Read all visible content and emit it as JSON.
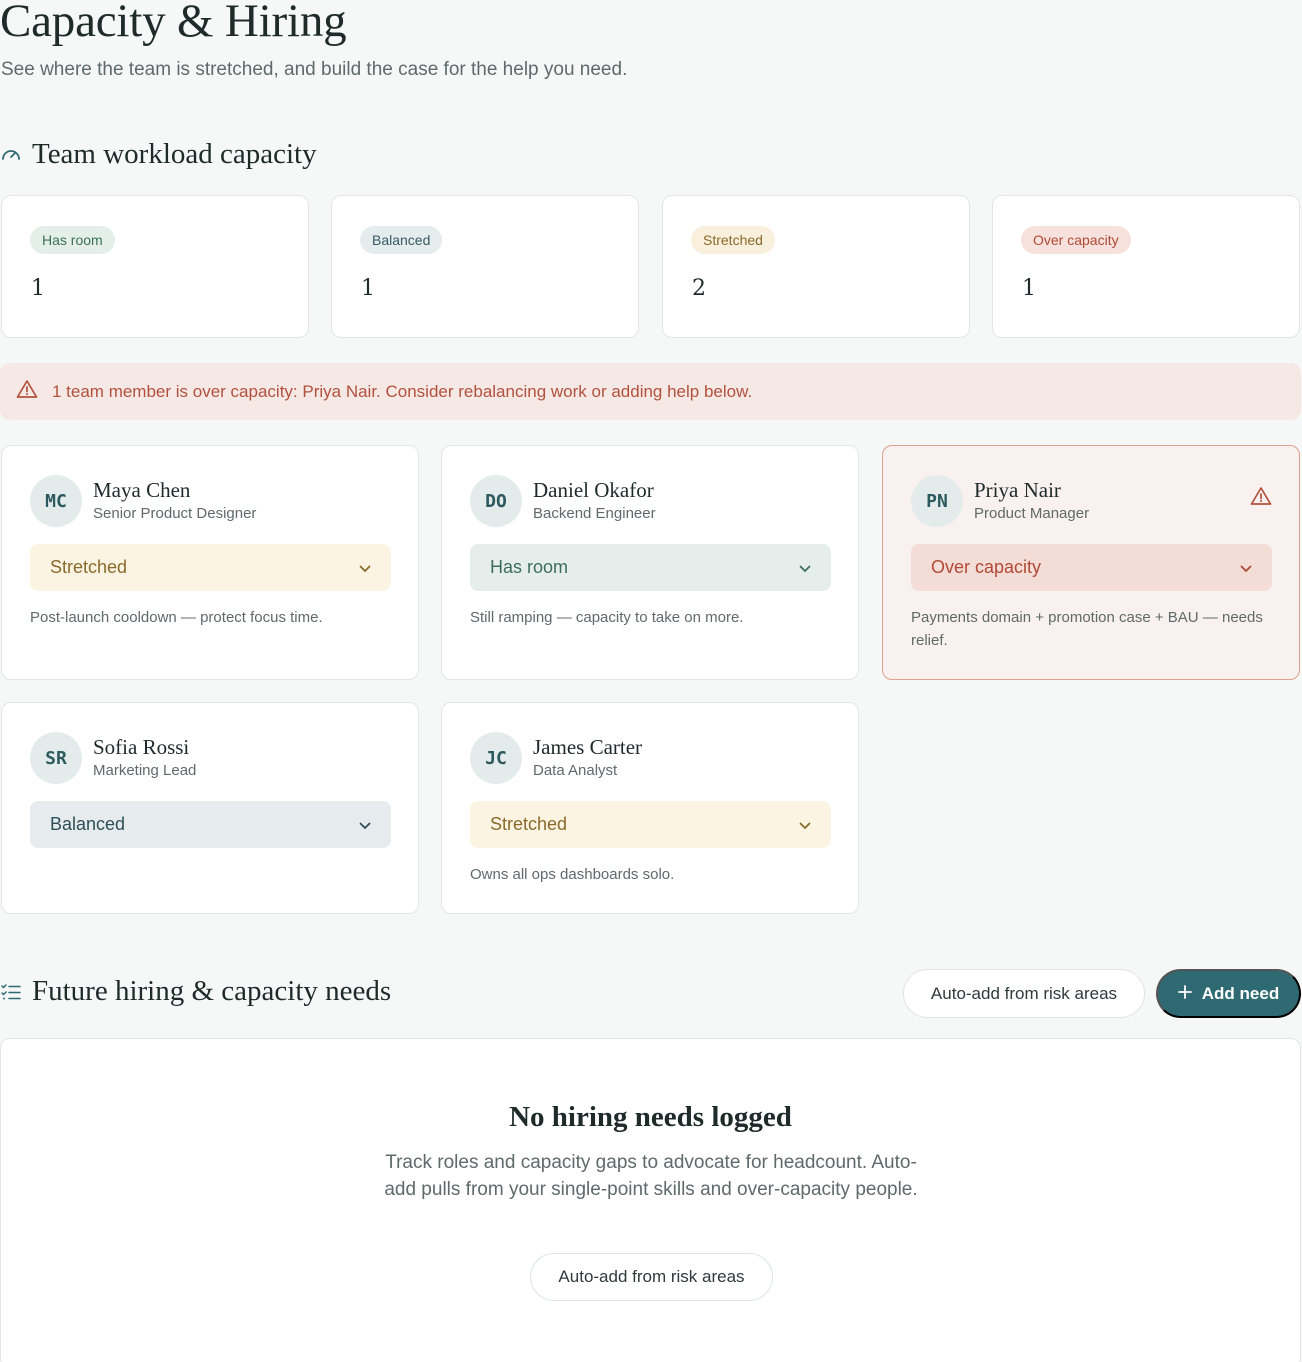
{
  "header": {
    "title": "Capacity & Hiring",
    "subtitle": "See where the team is stretched, and build the case for the help you need."
  },
  "workload": {
    "title": "Team workload capacity",
    "icon": "gauge-icon",
    "stats": [
      {
        "label": "Has room",
        "value": "1",
        "bg": "#e4efea",
        "fg": "#3e6d5e"
      },
      {
        "label": "Balanced",
        "value": "1",
        "bg": "#e5ecee",
        "fg": "#385a62"
      },
      {
        "label": "Stretched",
        "value": "2",
        "bg": "#f8f0dc",
        "fg": "#8a6a2a"
      },
      {
        "label": "Over capacity",
        "value": "1",
        "bg": "#f7e1dc",
        "fg": "#b14a36"
      }
    ],
    "alert": {
      "icon": "warning-icon",
      "text": "1 team member is over capacity: Priya Nair. Consider rebalancing work or adding help below."
    },
    "members": [
      {
        "initials": "MC",
        "name": "Maya Chen",
        "role": "Senior Product Designer",
        "status": "Stretched",
        "note": "Post-launch cooldown — protect focus time."
      },
      {
        "initials": "DO",
        "name": "Daniel Okafor",
        "role": "Backend Engineer",
        "status": "Has room",
        "note": "Still ramping — capacity to take on more."
      },
      {
        "initials": "PN",
        "name": "Priya Nair",
        "role": "Product Manager",
        "status": "Over capacity",
        "note": "Payments domain + promotion case + BAU — needs relief."
      },
      {
        "initials": "SR",
        "name": "Sofia Rossi",
        "role": "Marketing Lead",
        "status": "Balanced",
        "note": ""
      },
      {
        "initials": "JC",
        "name": "James Carter",
        "role": "Data Analyst",
        "status": "Stretched",
        "note": "Owns all ops dashboards solo."
      }
    ],
    "status_colors": {
      "Stretched": {
        "bg": "#fbf4e3",
        "fg": "#8a6a2a"
      },
      "Has room": {
        "bg": "#e6eeeb",
        "fg": "#3e6d5e"
      },
      "Over capacity": {
        "bg": "#f4ddd7",
        "fg": "#b14a36"
      },
      "Balanced": {
        "bg": "#e6ecee",
        "fg": "#2e4f57"
      }
    }
  },
  "hiring": {
    "title": "Future hiring & capacity needs",
    "icon": "checklist-icon",
    "auto_add_label": "Auto-add from risk areas",
    "add_need_label": "Add need",
    "empty": {
      "title": "No hiring needs logged",
      "description": "Track roles and capacity gaps to advocate for headcount. Auto-add pulls from your single-point skills and over-capacity people.",
      "button_label": "Auto-add from risk areas"
    }
  }
}
